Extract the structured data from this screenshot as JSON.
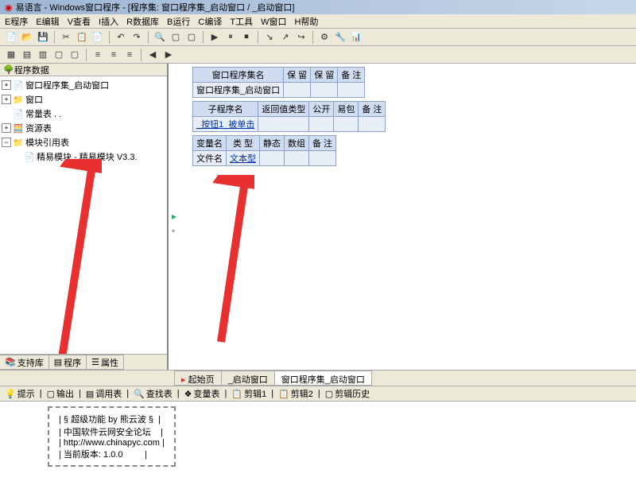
{
  "window": {
    "title": "易语言 - Windows窗口程序 - [程序集: 窗口程序集_启动窗口 / _启动窗口]"
  },
  "menu": [
    "E程序",
    "E编辑",
    "V查看",
    "I插入",
    "R数据库",
    "B运行",
    "C编译",
    "T工具",
    "W窗口",
    "H帮助"
  ],
  "sidebar": {
    "header": "程序数据",
    "nodes": [
      {
        "icon": "📄",
        "label": "窗口程序集_启动窗口"
      },
      {
        "icon": "📁",
        "label": "窗口"
      },
      {
        "icon": "📄",
        "label": "常量表 . ."
      },
      {
        "icon": "🧮",
        "label": "资源表"
      },
      {
        "icon": "📁",
        "label": "模块引用表",
        "expanded": true
      },
      {
        "icon": "📄",
        "label": "精易模块 - 精易模块 V3.3.",
        "child": true
      }
    ],
    "tabs": [
      "支持库",
      "程序",
      "属性"
    ]
  },
  "tables": {
    "t1": {
      "headers": [
        "窗口程序集名",
        "保 留",
        "保 留",
        "备 注"
      ],
      "rows": [
        [
          "窗口程序集_启动窗口",
          "",
          "",
          ""
        ]
      ]
    },
    "t2": {
      "headers": [
        "子程序名",
        "返回值类型",
        "公开",
        "易包",
        "备 注"
      ],
      "rows": [
        [
          "_按钮1_被单击",
          "",
          "",
          "",
          ""
        ]
      ]
    },
    "t3": {
      "headers": [
        "变量名",
        "类 型",
        "静态",
        "数组",
        "备 注"
      ],
      "rows": [
        [
          "文件名",
          "文本型",
          "",
          "",
          ""
        ]
      ]
    }
  },
  "bottom_tabs": [
    "起始页",
    "_启动窗口",
    "窗口程序集_启动窗口"
  ],
  "panel2": [
    "提示",
    "输出",
    "调用表",
    "查找表",
    "变量表",
    "剪辑1",
    "剪辑2",
    "剪辑历史"
  ],
  "output_lines": [
    "*==========================*",
    "| § 超级功能 by 熊云波 §  |",
    "| 中国软件云网安全论坛    |",
    "| http://www.chinapyc.com |",
    "| 当前版本: 1.0.0         |",
    "*==========================*"
  ]
}
